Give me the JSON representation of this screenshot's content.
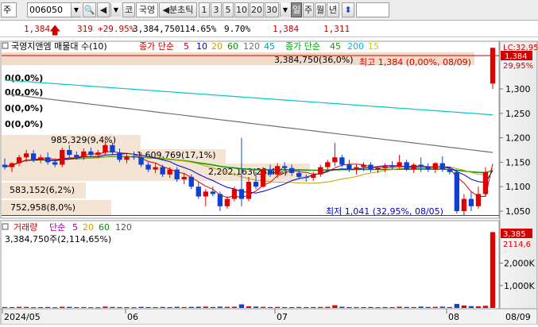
{
  "toolbar": {
    "market_label": "주",
    "code_value": "006050",
    "kospi_label": "코",
    "stock_name": "국영",
    "tick_label": "분초틱",
    "periods": [
      "1",
      "3",
      "5",
      "10",
      "20",
      "30"
    ],
    "period_suffix": "일",
    "day_label": "일",
    "week_label": "주",
    "month_label": "월",
    "year_label": "년",
    "colors": {
      "accent": "#d00000",
      "toolbar_bg": "#ececec"
    }
  },
  "quote": {
    "price": "1,384",
    "change": "319",
    "change_pct": "+29.95%",
    "volume": "3,384,750",
    "volume_ratio": "114.65%",
    "turnover": "9.70%",
    "price2": "1,384",
    "prev_close": "1,311"
  },
  "price_panel": {
    "legend_name": "국영지앤엠 매물대 수(10)",
    "ma_label": "종가 단순",
    "ma_periods": [
      "5",
      "10",
      "20",
      "60",
      "120",
      "45"
    ],
    "ma_label2": "종가 단순",
    "ma_periods2": [
      "45",
      "200",
      "15"
    ],
    "ma_colors": [
      "#ff0000",
      "#0000ff",
      "#c8a000",
      "#00a000",
      "#808080",
      "#00b0b0",
      "#00cccc",
      "#c8c800"
    ],
    "volume_profile": [
      {
        "label": "3,384,750(36,0%)",
        "side": "top"
      },
      {
        "label": "0(0,0%)"
      },
      {
        "label": "0(0,0%)"
      },
      {
        "label": "0(0,0%)"
      },
      {
        "label": "0(0,0%)"
      },
      {
        "label": "985,329(9,4%)"
      },
      {
        "label": "1,609,769(17,1%)"
      },
      {
        "label": "2,202,163(23,4%)"
      },
      {
        "label": "583,152(6,2%)"
      },
      {
        "label": "752,958(8,0%)"
      }
    ],
    "high_annotation": "최고 1,384 (0,00%, 08/09)",
    "low_annotation": "최저 1,041 (32,95%, 08/05)",
    "y_ticks": [
      "1,300",
      "1,250",
      "1,200",
      "1,150",
      "1,100",
      "1,050"
    ],
    "last_price_tag": "1,384",
    "last_pct_tag": "29,95%",
    "top_right_tag": "LC:32,95"
  },
  "volume_panel": {
    "legend_name": "거래량",
    "ma_label": "단순",
    "ma_periods": [
      "5",
      "20",
      "60",
      "120"
    ],
    "value_label": "3,384,750주(2,114,65%)",
    "y_ticks": [
      "2,000K",
      "1,000K"
    ],
    "last_volume_tag": "3,385",
    "last_volume_pct": "2114,6"
  },
  "x_axis": {
    "labels": [
      "2024/05",
      "06",
      "07",
      "08",
      "08/09"
    ]
  },
  "chart_data": {
    "type": "candlestick",
    "x": [
      "2024/05",
      "06",
      "07",
      "08",
      "08/09"
    ],
    "price_ylim": [
      1041,
      1384
    ],
    "high": 1384,
    "low": 1041,
    "last_close": 1384,
    "prev_close": 1311,
    "candles": [
      {
        "o": 1145,
        "h": 1158,
        "l": 1135,
        "c": 1140
      },
      {
        "o": 1140,
        "h": 1150,
        "l": 1130,
        "c": 1148
      },
      {
        "o": 1148,
        "h": 1165,
        "l": 1142,
        "c": 1160
      },
      {
        "o": 1160,
        "h": 1175,
        "l": 1150,
        "c": 1168
      },
      {
        "o": 1168,
        "h": 1175,
        "l": 1150,
        "c": 1155
      },
      {
        "o": 1155,
        "h": 1165,
        "l": 1148,
        "c": 1160
      },
      {
        "o": 1160,
        "h": 1170,
        "l": 1145,
        "c": 1150
      },
      {
        "o": 1150,
        "h": 1158,
        "l": 1140,
        "c": 1145
      },
      {
        "o": 1145,
        "h": 1180,
        "l": 1140,
        "c": 1175
      },
      {
        "o": 1175,
        "h": 1185,
        "l": 1160,
        "c": 1165
      },
      {
        "o": 1165,
        "h": 1172,
        "l": 1155,
        "c": 1160
      },
      {
        "o": 1160,
        "h": 1178,
        "l": 1155,
        "c": 1172
      },
      {
        "o": 1172,
        "h": 1180,
        "l": 1160,
        "c": 1165
      },
      {
        "o": 1165,
        "h": 1175,
        "l": 1158,
        "c": 1170
      },
      {
        "o": 1170,
        "h": 1195,
        "l": 1165,
        "c": 1185
      },
      {
        "o": 1185,
        "h": 1190,
        "l": 1165,
        "c": 1170
      },
      {
        "o": 1170,
        "h": 1178,
        "l": 1150,
        "c": 1155
      },
      {
        "o": 1155,
        "h": 1168,
        "l": 1148,
        "c": 1162
      },
      {
        "o": 1162,
        "h": 1172,
        "l": 1155,
        "c": 1160
      },
      {
        "o": 1160,
        "h": 1170,
        "l": 1140,
        "c": 1145
      },
      {
        "o": 1145,
        "h": 1150,
        "l": 1130,
        "c": 1135
      },
      {
        "o": 1135,
        "h": 1148,
        "l": 1128,
        "c": 1140
      },
      {
        "o": 1140,
        "h": 1145,
        "l": 1120,
        "c": 1125
      },
      {
        "o": 1125,
        "h": 1140,
        "l": 1118,
        "c": 1135
      },
      {
        "o": 1135,
        "h": 1140,
        "l": 1110,
        "c": 1115
      },
      {
        "o": 1115,
        "h": 1128,
        "l": 1105,
        "c": 1120
      },
      {
        "o": 1120,
        "h": 1125,
        "l": 1095,
        "c": 1100
      },
      {
        "o": 1100,
        "h": 1110,
        "l": 1075,
        "c": 1080
      },
      {
        "o": 1080,
        "h": 1095,
        "l": 1060,
        "c": 1090
      },
      {
        "o": 1090,
        "h": 1100,
        "l": 1080,
        "c": 1085
      },
      {
        "o": 1085,
        "h": 1090,
        "l": 1050,
        "c": 1060
      },
      {
        "o": 1060,
        "h": 1080,
        "l": 1055,
        "c": 1075
      },
      {
        "o": 1075,
        "h": 1100,
        "l": 1070,
        "c": 1095
      },
      {
        "o": 1095,
        "h": 1200,
        "l": 1060,
        "c": 1075
      },
      {
        "o": 1075,
        "h": 1120,
        "l": 1070,
        "c": 1110
      },
      {
        "o": 1110,
        "h": 1130,
        "l": 1095,
        "c": 1100
      },
      {
        "o": 1100,
        "h": 1140,
        "l": 1098,
        "c": 1135
      },
      {
        "o": 1135,
        "h": 1145,
        "l": 1120,
        "c": 1125
      },
      {
        "o": 1125,
        "h": 1148,
        "l": 1118,
        "c": 1142
      },
      {
        "o": 1142,
        "h": 1150,
        "l": 1130,
        "c": 1138
      },
      {
        "o": 1138,
        "h": 1145,
        "l": 1122,
        "c": 1128
      },
      {
        "o": 1128,
        "h": 1135,
        "l": 1115,
        "c": 1120
      },
      {
        "o": 1120,
        "h": 1125,
        "l": 1110,
        "c": 1118
      },
      {
        "o": 1118,
        "h": 1130,
        "l": 1112,
        "c": 1125
      },
      {
        "o": 1125,
        "h": 1145,
        "l": 1120,
        "c": 1140
      },
      {
        "o": 1140,
        "h": 1155,
        "l": 1135,
        "c": 1150
      },
      {
        "o": 1150,
        "h": 1190,
        "l": 1142,
        "c": 1160
      },
      {
        "o": 1160,
        "h": 1165,
        "l": 1140,
        "c": 1145
      },
      {
        "o": 1145,
        "h": 1155,
        "l": 1130,
        "c": 1135
      },
      {
        "o": 1135,
        "h": 1145,
        "l": 1125,
        "c": 1140
      },
      {
        "o": 1140,
        "h": 1150,
        "l": 1132,
        "c": 1145
      },
      {
        "o": 1145,
        "h": 1150,
        "l": 1130,
        "c": 1135
      },
      {
        "o": 1135,
        "h": 1142,
        "l": 1128,
        "c": 1138
      },
      {
        "o": 1138,
        "h": 1148,
        "l": 1130,
        "c": 1142
      },
      {
        "o": 1142,
        "h": 1152,
        "l": 1135,
        "c": 1140
      },
      {
        "o": 1140,
        "h": 1165,
        "l": 1138,
        "c": 1150
      },
      {
        "o": 1150,
        "h": 1155,
        "l": 1132,
        "c": 1135
      },
      {
        "o": 1135,
        "h": 1148,
        "l": 1128,
        "c": 1145
      },
      {
        "o": 1145,
        "h": 1160,
        "l": 1130,
        "c": 1140
      },
      {
        "o": 1140,
        "h": 1148,
        "l": 1130,
        "c": 1135
      },
      {
        "o": 1135,
        "h": 1150,
        "l": 1128,
        "c": 1148
      },
      {
        "o": 1148,
        "h": 1162,
        "l": 1130,
        "c": 1135
      },
      {
        "o": 1135,
        "h": 1140,
        "l": 1125,
        "c": 1130
      },
      {
        "o": 1130,
        "h": 1135,
        "l": 1045,
        "c": 1050
      },
      {
        "o": 1050,
        "h": 1085,
        "l": 1041,
        "c": 1075
      },
      {
        "o": 1075,
        "h": 1090,
        "l": 1050,
        "c": 1060
      },
      {
        "o": 1060,
        "h": 1100,
        "l": 1055,
        "c": 1085
      },
      {
        "o": 1085,
        "h": 1140,
        "l": 1080,
        "c": 1130
      },
      {
        "o": 1311,
        "h": 1384,
        "l": 1300,
        "c": 1384
      }
    ],
    "volume": [
      40,
      35,
      50,
      45,
      30,
      38,
      42,
      30,
      55,
      48,
      36,
      40,
      32,
      30,
      60,
      45,
      38,
      35,
      30,
      50,
      40,
      36,
      44,
      38,
      52,
      40,
      48,
      55,
      60,
      42,
      58,
      50,
      55,
      160,
      70,
      60,
      48,
      40,
      45,
      38,
      35,
      42,
      36,
      40,
      44,
      50,
      120,
      55,
      40,
      38,
      36,
      42,
      34,
      40,
      38,
      55,
      45,
      40,
      60,
      44,
      48,
      58,
      40,
      180,
      110,
      80,
      70,
      95,
      3385
    ],
    "volume_unit": "K",
    "volume_ylim": [
      0,
      3400
    ]
  }
}
